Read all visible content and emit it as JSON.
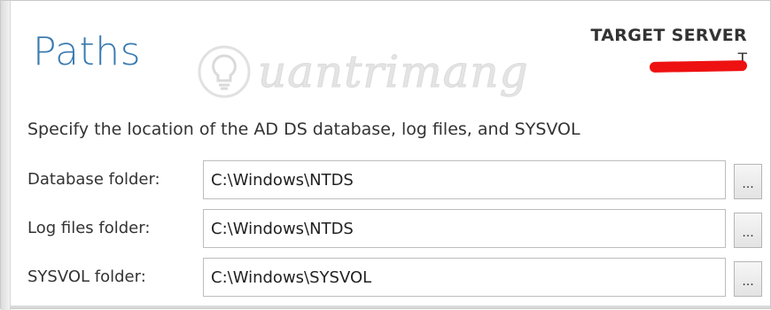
{
  "header": {
    "title": "Paths",
    "target_label": "TARGET SERVER",
    "target_value": "T"
  },
  "watermark": {
    "text": "uantrimang",
    "icon": "lightbulb-logo-icon"
  },
  "instruction": "Specify the location of the AD DS database, log files, and SYSVOL",
  "fields": [
    {
      "label": "Database folder:",
      "value": "C:\\Windows\\NTDS",
      "browse_label": "..."
    },
    {
      "label": "Log files folder:",
      "value": "C:\\Windows\\NTDS",
      "browse_label": "..."
    },
    {
      "label": "SYSVOL folder:",
      "value": "C:\\Windows\\SYSVOL",
      "browse_label": "..."
    }
  ],
  "colors": {
    "title": "#3a7bb0",
    "redaction": "#ee1111",
    "text": "#333333"
  }
}
